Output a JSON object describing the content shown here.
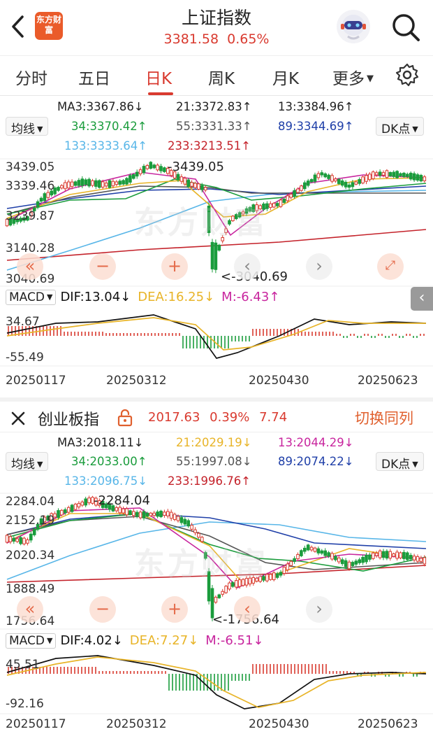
{
  "header": {
    "back_icon": "chevron-left-icon",
    "logo_text": "东方财富",
    "title": "上证指数",
    "price": "3381.58",
    "change_pct": "0.65%",
    "assistant_icon": "robot-avatar-icon",
    "search_icon": "search-icon"
  },
  "tabs": [
    {
      "label": "分时"
    },
    {
      "label": "五日"
    },
    {
      "label": "日K"
    },
    {
      "label": "周K"
    },
    {
      "label": "月K"
    },
    {
      "label": "更多"
    }
  ],
  "active_tab": "日K",
  "settings_icon": "gear-icon",
  "colors": {
    "up": "#d93a2f",
    "down": "#1a9c3c",
    "ma3": "#222222",
    "ma21": "#e8b428",
    "ma13": "#c8259e",
    "ma34": "#1a9c3c",
    "ma55": "#555555",
    "ma89": "#1f3fa8",
    "ma133": "#58b6e8",
    "ma233": "#c4222a",
    "dif": "#111111",
    "dea": "#e8b428",
    "macd_m": "#c8259e",
    "switch": "#e0602e"
  },
  "top": {
    "ma_selector": "均线",
    "dk_button": "DK点",
    "ma": {
      "ma3": "MA3:3367.86↓",
      "ma21": "21:3372.83↑",
      "ma13": "13:3384.96↑",
      "ma34": "34:3370.42↑",
      "ma55": "55:3331.33↑",
      "ma89": "89:3344.69↑",
      "ma133": "133:3333.64↑",
      "ma233": "233:3213.51↑"
    },
    "y_labels": [
      "3439.05",
      "3339.46",
      "3239.87",
      "3140.28",
      "3040.69"
    ],
    "high_label": "3439.05",
    "low_label": "<-3040.69",
    "macd": {
      "selector": "MACD",
      "dif": "DIF:13.04↓",
      "dea": "DEA:16.25↓",
      "m": "M:-6.43↑",
      "y_top": "34.67",
      "y_bottom": "-55.49"
    },
    "dates": [
      "20250117",
      "20250312",
      "20250430",
      "20250623"
    ],
    "watermark": "东方财富"
  },
  "bottom": {
    "close_icon": "close-icon",
    "name": "创业板指",
    "lock_icon": "lock-icon",
    "price": "2017.63",
    "change_pct": "0.39%",
    "change": "7.74",
    "switch_label": "切换同列",
    "ma_selector": "均线",
    "dk_button": "DK点",
    "ma": {
      "ma3": "MA3:2018.11↓",
      "ma21": "21:2029.19↓",
      "ma13": "13:2044.29↓",
      "ma34": "34:2033.00↑",
      "ma55": "55:1997.08↓",
      "ma89": "89:2074.22↓",
      "ma133": "133:2096.75↓",
      "ma233": "233:1996.76↑"
    },
    "y_labels": [
      "2284.04",
      "2152.19",
      "2020.34",
      "1888.49",
      "1756.64"
    ],
    "high_label": "2284.04",
    "low_label": "<-1756.64",
    "macd": {
      "selector": "MACD",
      "dif": "DIF:4.02↓",
      "dea": "DEA:7.27↓",
      "m": "M:-6.51↓",
      "y_top": "45.51",
      "y_bottom": "-92.16"
    },
    "dates": [
      "20250117",
      "20250312",
      "20250430",
      "20250623"
    ],
    "watermark": "东方财富"
  }
}
